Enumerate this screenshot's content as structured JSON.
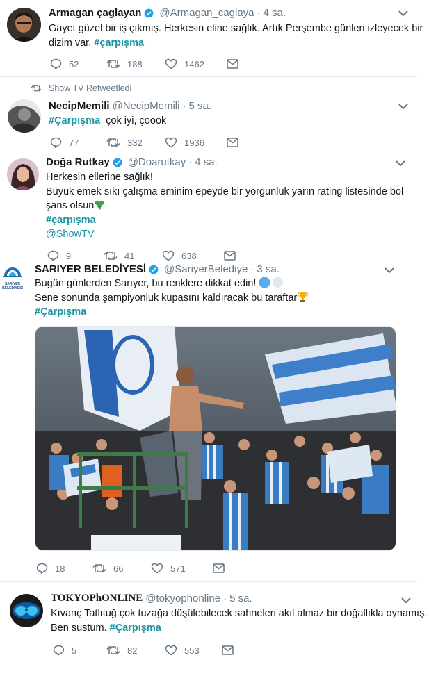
{
  "tweets": [
    {
      "name": "Armagan çaglayan",
      "handle": "@Armagan_caglaya",
      "time": "4 sa.",
      "text_line1": "Gayet güzel bir iş çıkmış. Herkesin eline sağlık. Artık Perşembe günleri izleyecek bir",
      "text_line2": "dizim var.",
      "hashtag": "#çarpışma",
      "replies": "52",
      "retweets": "188",
      "likes": "1462"
    },
    {
      "retweeted_by": "Show TV Retweetledi",
      "name": "NecipMemili",
      "handle": "@NecipMemili",
      "time": "5 sa.",
      "hashtag": "#Çarpışma",
      "text": "çok iyi, çoook",
      "replies": "77",
      "retweets": "332",
      "likes": "1936"
    },
    {
      "name": "Doğa Rutkay",
      "handle": "@Doarutkay",
      "time": "4 sa.",
      "text_line1": "Herkesin ellerine sağlık!",
      "text_line2": "Büyük emek sıkı çalışma eminim epeyde bir yorgunluk yarın rating listesinde bol",
      "text_line3": "şans olsun",
      "hashtag": "#çarpışma",
      "mention": "@ShowTV",
      "replies": "9",
      "retweets": "41",
      "likes": "638"
    },
    {
      "name": "SARIYER BELEDİYESİ",
      "handle": "@SariyerBelediye",
      "time": "3 sa.",
      "avatar_text": "SARIYER BELEDİYESİ",
      "text_line1": "Bugün günlerden Sarıyer, bu renklere dikkat edin!",
      "text_line2": "Sene sonunda şampiyonluk kupasını kaldıracak bu taraftar",
      "hashtag": "#Çarpışma",
      "replies": "18",
      "retweets": "66",
      "likes": "571"
    },
    {
      "name": "TOKYOPhONLINE",
      "handle": "@tokyophonline",
      "time": "5 sa.",
      "text_line1": "Kıvanç Tatlıtuğ çok tuzağa düşülebilecek sahneleri akıl almaz bir doğallıkla oynamış.",
      "text_line2": "Ben sustum.",
      "hashtag": "#Çarpışma",
      "replies": "5",
      "retweets": "82",
      "likes": "553"
    }
  ],
  "colors": {
    "accent": "#1b95a0",
    "verified": "#1da1f2",
    "muted": "#657786",
    "separator": "#e6ecf0"
  },
  "icons": [
    "reply-icon",
    "retweet-icon",
    "like-icon",
    "message-icon",
    "chevron-down-icon",
    "verified-icon",
    "shamrock-icon",
    "trophy-icon",
    "blue-circle-icon",
    "white-circle-icon"
  ]
}
